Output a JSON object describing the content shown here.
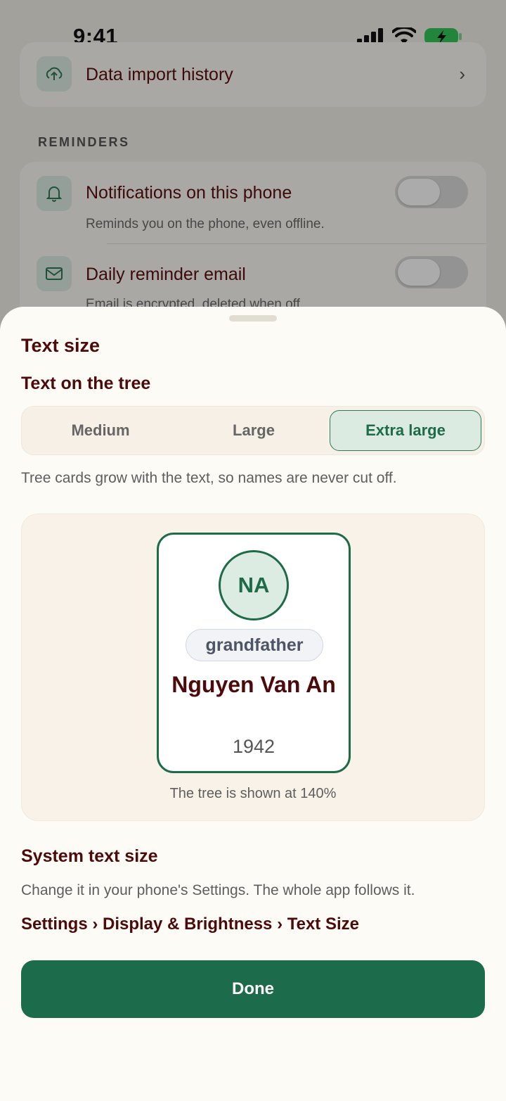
{
  "status_bar": {
    "time": "9:41"
  },
  "background": {
    "top_row": {
      "title": "Data import history"
    },
    "reminders_section": "REMINDERS",
    "notifications_row": {
      "title": "Notifications on this phone",
      "subtitle": "Reminds you on the phone, even offline."
    },
    "email_row": {
      "title": "Daily reminder email",
      "subtitle": "Email is encrypted, deleted when off."
    }
  },
  "sheet": {
    "title": "Text size",
    "tree_section_title": "Text on the tree",
    "size_options": [
      "Medium",
      "Large",
      "Extra large"
    ],
    "selected_option": "Extra large",
    "tree_helper": "Tree cards grow with the text, so names are never cut off.",
    "preview": {
      "initials": "NA",
      "relation": "grandfather",
      "name": "Nguyen Van An",
      "year": "1942",
      "scale_note": "The tree is shown at 140%"
    },
    "system_section_title": "System text size",
    "system_helper": "Change it in your phone's Settings. The whole app follows it.",
    "settings_path": "Settings › Display & Brightness › Text Size",
    "done_label": "Done"
  },
  "colors": {
    "accent": "#1c6b4a",
    "title": "#4e0a0a",
    "sheet_bg": "#fdfbf6"
  }
}
